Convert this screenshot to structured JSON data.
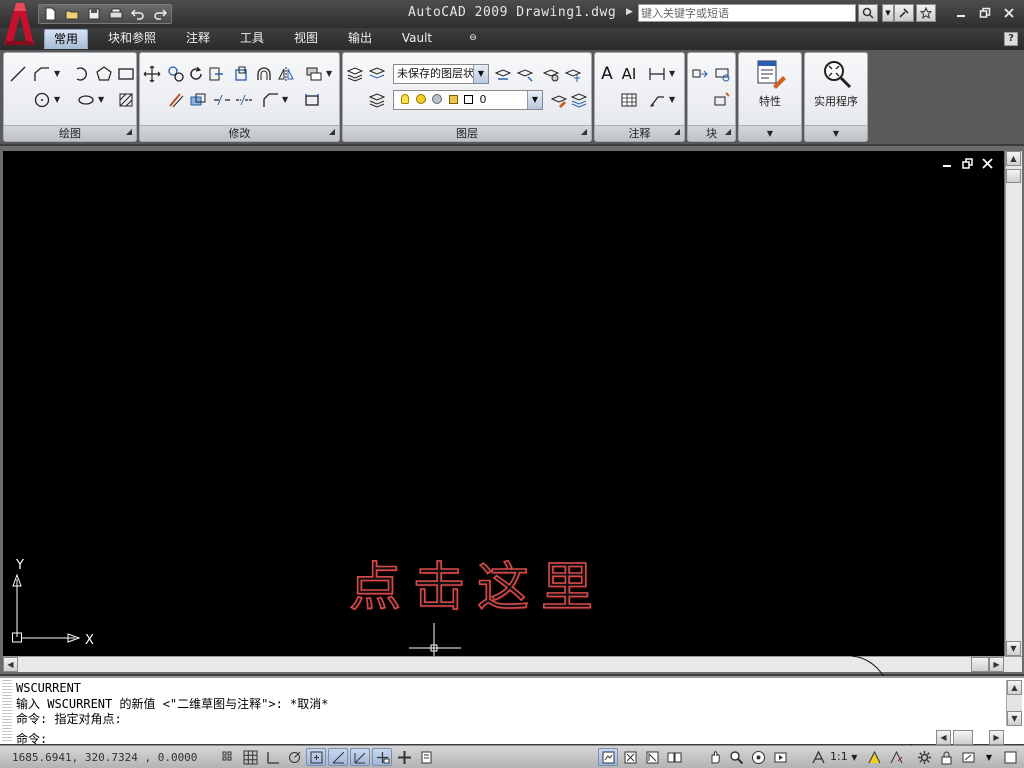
{
  "titlebar": {
    "title": "AutoCAD 2009 Drawing1.dwg",
    "search_placeholder": "键入关键字或短语",
    "qat_buttons": [
      "new-icon",
      "open-icon",
      "save-icon",
      "print-icon",
      "undo-icon",
      "redo-icon"
    ]
  },
  "ribbon": {
    "tabs": [
      "常用",
      "块和参照",
      "注释",
      "工具",
      "视图",
      "输出",
      "Vault"
    ],
    "active_tab": "常用",
    "panels": {
      "draw": "绘图",
      "modify": "修改",
      "layers": "图层",
      "annotation": "注释",
      "block": "块"
    },
    "layer_state_combo": "未保存的图层状态",
    "layer_combo": "0",
    "properties_label": "特性",
    "utilities_label": "实用程序"
  },
  "canvas": {
    "overlay_text": "点击这里",
    "ucs_x": "X",
    "ucs_y": "Y",
    "background": "#000000",
    "overlay_stroke_color": "#d84a4a"
  },
  "command_line": {
    "history": [
      "WSCURRENT",
      "输入 WSCURRENT 的新值 <\"二维草图与注释\">: *取消*",
      "命令: 指定对角点:"
    ],
    "prompt": "命令:"
  },
  "statusbar": {
    "coordinates": "1685.6941, 320.7324 , 0.0000",
    "annotation_scale": "1:1"
  },
  "colors": {
    "accent": "#b8c8e0",
    "logo_red": "#c8102e"
  }
}
